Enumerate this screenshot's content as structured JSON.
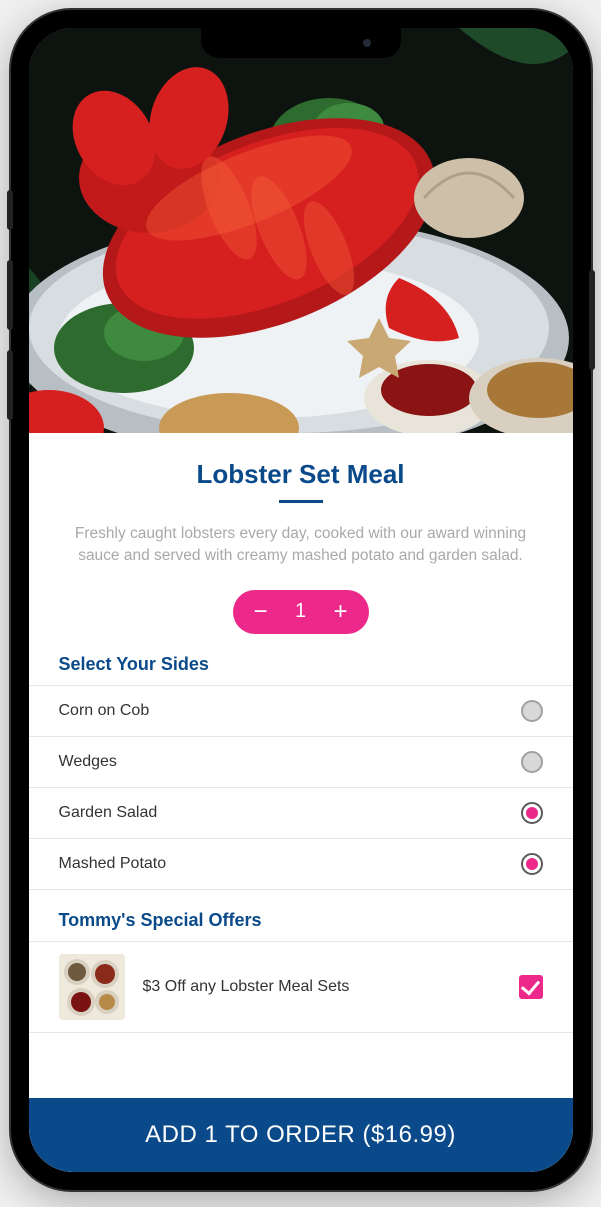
{
  "product": {
    "title": "Lobster Set Meal",
    "description": "Freshly caught lobsters every day, cooked with our award winning sauce and served with creamy mashed potato and garden salad."
  },
  "quantity": {
    "value": "1",
    "minus": "−",
    "plus": "+"
  },
  "sides": {
    "header": "Select Your Sides",
    "items": [
      {
        "label": "Corn on Cob",
        "selected": false
      },
      {
        "label": "Wedges",
        "selected": false
      },
      {
        "label": "Garden Salad",
        "selected": true
      },
      {
        "label": "Mashed Potato",
        "selected": true
      }
    ]
  },
  "offers": {
    "header": "Tommy's Special Offers",
    "items": [
      {
        "label": "$3 Off any Lobster Meal Sets",
        "checked": true
      }
    ]
  },
  "cta": {
    "label": "ADD 1 TO ORDER ($16.99)"
  },
  "colors": {
    "brand_blue": "#0a4a8a",
    "brand_pink": "#ec298a"
  }
}
